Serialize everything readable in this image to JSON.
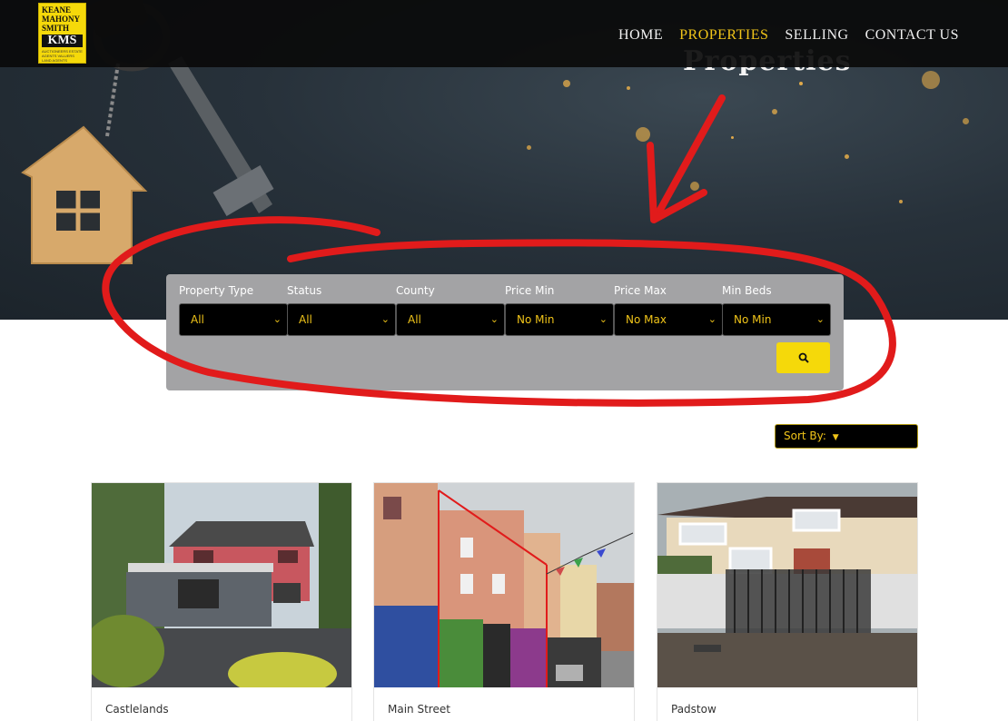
{
  "nav": {
    "logo": {
      "line1": "KEANE",
      "line2": "MAHONY",
      "line3": "SMITH",
      "mark": "KMS",
      "tagline": "AUCTIONEERS ESTATE AGENTS VALUERS LAND AGENTS"
    },
    "links": [
      {
        "label": "HOME",
        "active": false
      },
      {
        "label": "PROPERTIES",
        "active": true
      },
      {
        "label": "SELLING",
        "active": false
      },
      {
        "label": "CONTACT US",
        "active": false
      }
    ]
  },
  "hero": {
    "title": "Properties"
  },
  "search": {
    "fields": [
      {
        "label": "Property Type",
        "value": "All"
      },
      {
        "label": "Status",
        "value": "All"
      },
      {
        "label": "County",
        "value": "All"
      },
      {
        "label": "Price Min",
        "value": "No Min"
      },
      {
        "label": "Price Max",
        "value": "No Max"
      },
      {
        "label": "Min Beds",
        "value": "No Min"
      }
    ],
    "button_icon": "search-icon"
  },
  "sort": {
    "label": "Sort By:",
    "icon": "caret-down-icon"
  },
  "listings": [
    {
      "title": "Castlelands"
    },
    {
      "title": "Main Street"
    },
    {
      "title": "Padstow"
    }
  ],
  "colors": {
    "accent": "#f0c419",
    "button": "#f5d90a",
    "panel": "#a3a3a5",
    "annotation": "#e11b1b"
  }
}
